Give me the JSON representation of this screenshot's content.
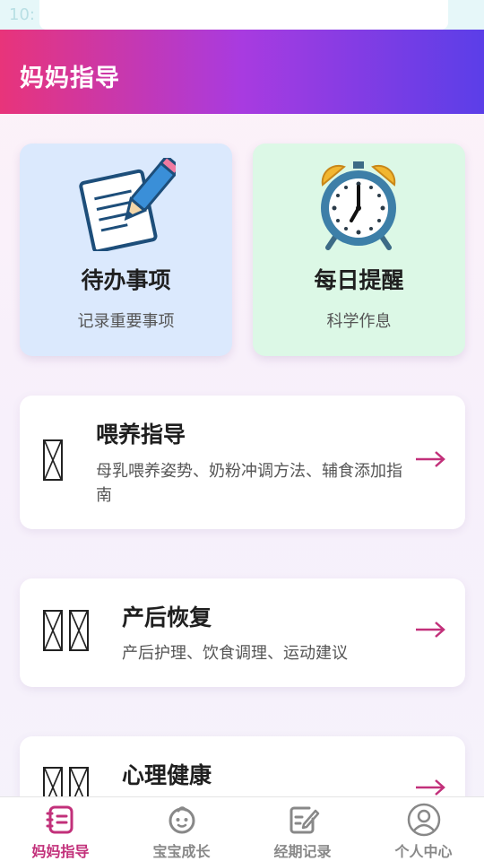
{
  "status_bar": {
    "time": "10:"
  },
  "header": {
    "title": "妈妈指导"
  },
  "top_cards": [
    {
      "title": "待办事项",
      "subtitle": "记录重要事项",
      "icon": "memo-icon",
      "bg": "#dbe9fd"
    },
    {
      "title": "每日提醒",
      "subtitle": "科学作息",
      "icon": "alarm-clock-icon",
      "bg": "#dcf8e6"
    }
  ],
  "list_cards": [
    {
      "title": "喂养指导",
      "description": "母乳喂养姿势、奶粉冲调方法、辅食添加指南",
      "icon": "missing-glyph-icon",
      "glyph_count": 1
    },
    {
      "title": "产后恢复",
      "description": "产后护理、饮食调理、运动建议",
      "icon": "missing-glyph-icon",
      "glyph_count": 2
    },
    {
      "title": "心理健康",
      "description": "",
      "icon": "missing-glyph-icon",
      "glyph_count": 2
    }
  ],
  "tabs": [
    {
      "label": "妈妈指导",
      "icon": "note-list-icon",
      "active": true
    },
    {
      "label": "宝宝成长",
      "icon": "baby-face-icon",
      "active": false
    },
    {
      "label": "经期记录",
      "icon": "edit-note-icon",
      "active": false
    },
    {
      "label": "个人中心",
      "icon": "user-avatar-icon",
      "active": false
    }
  ],
  "colors": {
    "accent": "#c2307a",
    "header_gradient": [
      "#e8347a",
      "#a83be0",
      "#5b3ee8"
    ],
    "inactive_tab": "#888888"
  }
}
